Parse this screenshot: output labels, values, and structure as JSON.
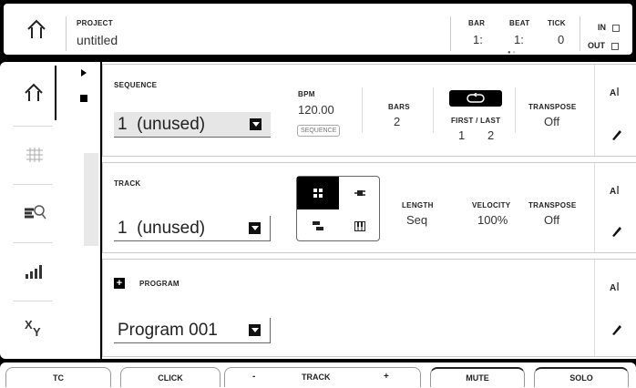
{
  "header": {
    "project_label": "PROJECT",
    "project_name": "untitled",
    "bar_label": "BAR",
    "bar_value": "1:",
    "beat_label": "BEAT",
    "beat_value": "1:",
    "tick_label": "TICK",
    "tick_value": "0",
    "in_label": "IN",
    "out_label": "OUT"
  },
  "rail": {
    "items": [
      "home",
      "grid",
      "list-search",
      "levels",
      "xy"
    ]
  },
  "sequence": {
    "label": "SEQUENCE",
    "value": "1  (unused)",
    "bpm_label": "BPM",
    "bpm_value": "120.00",
    "bpm_mode": "SEQUENCE",
    "bars_label": "BARS",
    "bars_value": "2",
    "first_last_label": "FIRST / LAST",
    "first_value": "1",
    "last_value": "2",
    "transpose_label": "TRANSPOSE",
    "transpose_value": "Off"
  },
  "track": {
    "label": "TRACK",
    "value": "1  (unused)",
    "length_label": "LENGTH",
    "length_value": "Seq",
    "velocity_label": "VELOCITY",
    "velocity_value": "100%",
    "transpose_label": "TRANSPOSE",
    "transpose_value": "Off"
  },
  "program": {
    "label": "PROGRAM",
    "value": "Program 001"
  },
  "footer": {
    "tc": "TC",
    "click": "CLICK",
    "minus": "-",
    "track": "TRACK",
    "plus": "+",
    "mute": "MUTE",
    "solo": "SOLO"
  }
}
